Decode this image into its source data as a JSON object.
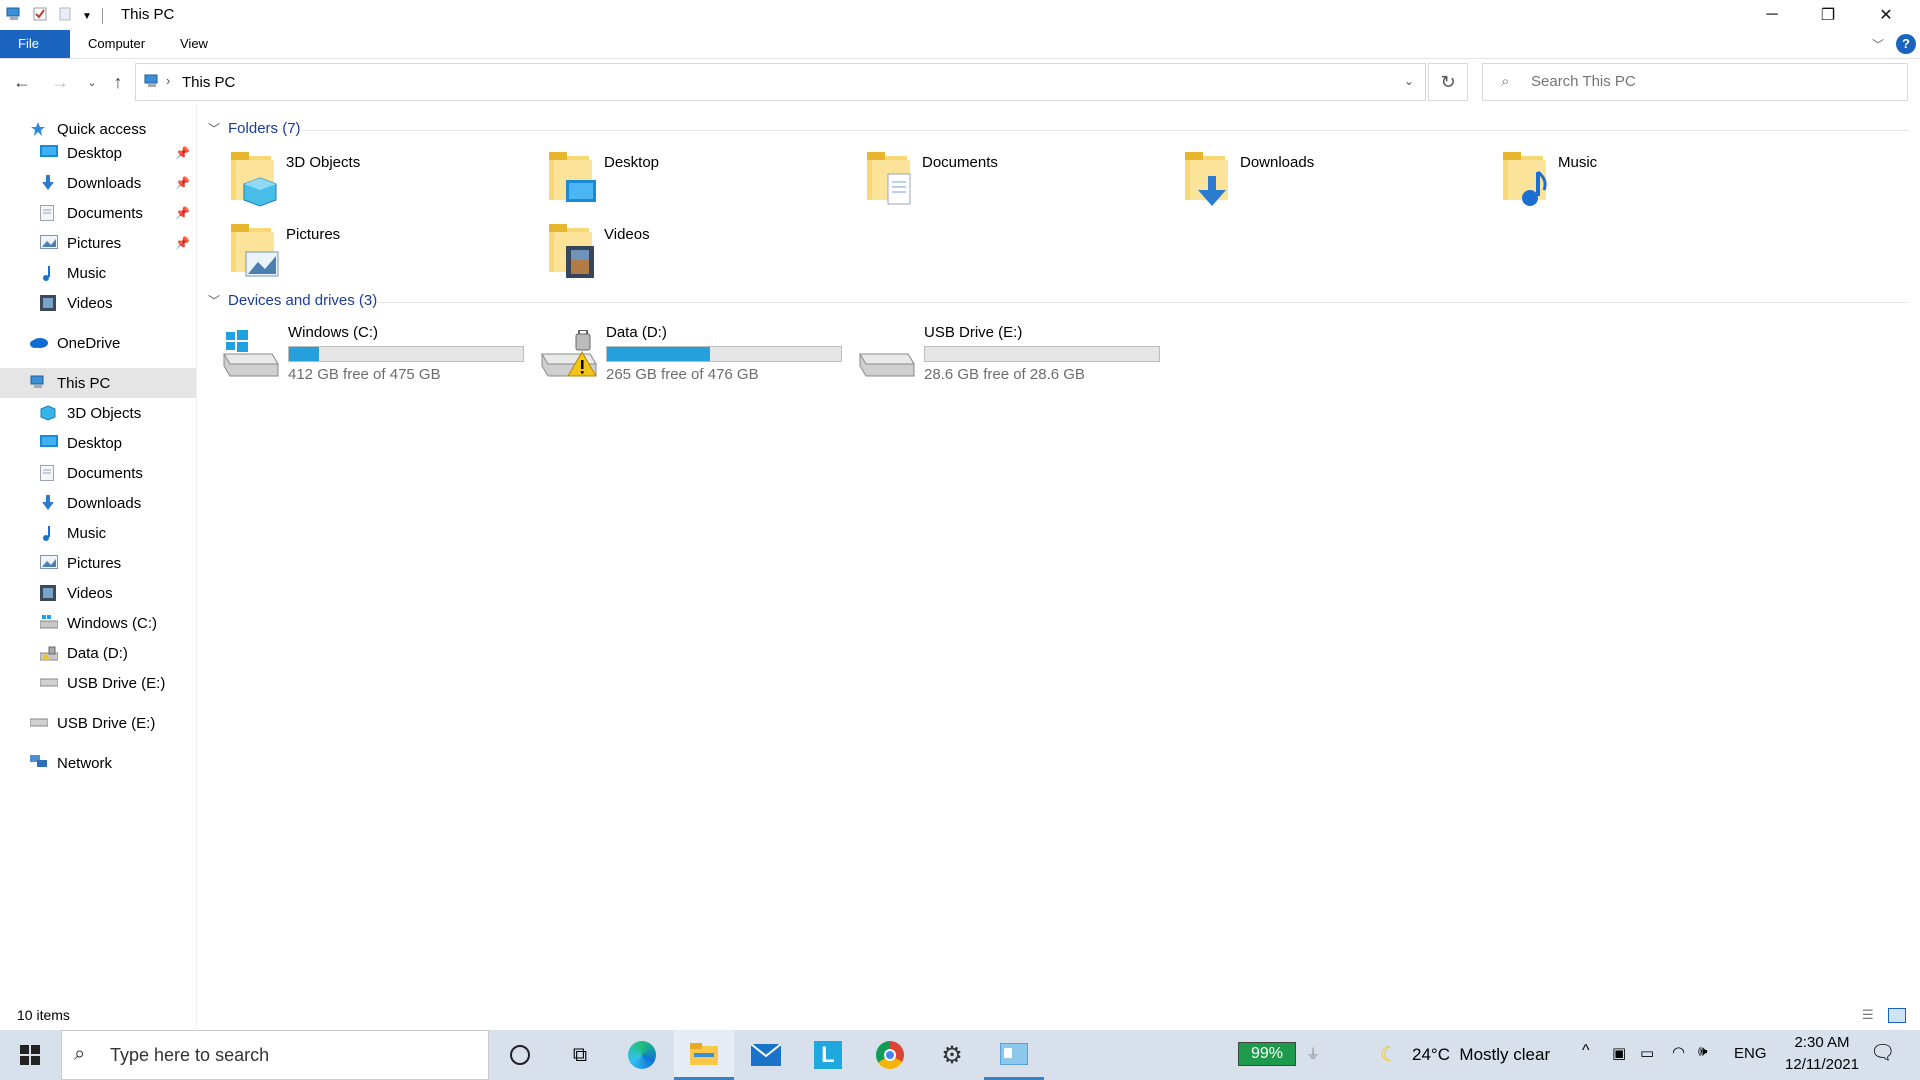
{
  "window": {
    "title": "This PC"
  },
  "ribbon": {
    "tabs": [
      "File",
      "Computer",
      "View"
    ]
  },
  "address": {
    "path": "This PC",
    "search_placeholder": "Search This PC"
  },
  "sidebar": {
    "items": [
      {
        "label": "Quick access",
        "icon": "star-icon",
        "indent": 0,
        "pinned": false
      },
      {
        "label": "Desktop",
        "icon": "desktop-icon",
        "indent": 1,
        "pinned": true
      },
      {
        "label": "Downloads",
        "icon": "downloads-icon",
        "indent": 1,
        "pinned": true
      },
      {
        "label": "Documents",
        "icon": "documents-icon",
        "indent": 1,
        "pinned": true
      },
      {
        "label": "Pictures",
        "icon": "pictures-icon",
        "indent": 1,
        "pinned": true
      },
      {
        "label": "Music",
        "icon": "music-icon",
        "indent": 1,
        "pinned": false
      },
      {
        "label": "Videos",
        "icon": "videos-icon",
        "indent": 1,
        "pinned": false
      },
      {
        "label": "OneDrive",
        "icon": "cloud-icon",
        "indent": 0,
        "pinned": false
      },
      {
        "label": "This PC",
        "icon": "computer-icon",
        "indent": 0,
        "pinned": false,
        "selected": true
      },
      {
        "label": "3D Objects",
        "icon": "3d-objects-icon",
        "indent": 1,
        "pinned": false
      },
      {
        "label": "Desktop",
        "icon": "desktop-icon",
        "indent": 1,
        "pinned": false
      },
      {
        "label": "Documents",
        "icon": "documents-icon",
        "indent": 1,
        "pinned": false
      },
      {
        "label": "Downloads",
        "icon": "downloads-icon",
        "indent": 1,
        "pinned": false
      },
      {
        "label": "Music",
        "icon": "music-icon",
        "indent": 1,
        "pinned": false
      },
      {
        "label": "Pictures",
        "icon": "pictures-icon",
        "indent": 1,
        "pinned": false
      },
      {
        "label": "Videos",
        "icon": "videos-icon",
        "indent": 1,
        "pinned": false
      },
      {
        "label": "Windows (C:)",
        "icon": "windows-drive-icon",
        "indent": 1,
        "pinned": false
      },
      {
        "label": "Data (D:)",
        "icon": "locked-drive-icon",
        "indent": 1,
        "pinned": false
      },
      {
        "label": "USB Drive (E:)",
        "icon": "usb-drive-icon",
        "indent": 1,
        "pinned": false
      },
      {
        "label": "USB Drive (E:)",
        "icon": "usb-drive-icon",
        "indent": 0,
        "pinned": false
      },
      {
        "label": "Network",
        "icon": "network-icon",
        "indent": 0,
        "pinned": false
      }
    ]
  },
  "content": {
    "folders_header": "Folders (7)",
    "folders": [
      {
        "name": "3D Objects",
        "icon": "3d-objects-folder-icon"
      },
      {
        "name": "Desktop",
        "icon": "desktop-folder-icon"
      },
      {
        "name": "Documents",
        "icon": "documents-folder-icon"
      },
      {
        "name": "Downloads",
        "icon": "downloads-folder-icon"
      },
      {
        "name": "Music",
        "icon": "music-folder-icon"
      },
      {
        "name": "Pictures",
        "icon": "pictures-folder-icon"
      },
      {
        "name": "Videos",
        "icon": "videos-folder-icon"
      }
    ],
    "drives_header": "Devices and drives (3)",
    "drives": [
      {
        "name": "Windows (C:)",
        "free_text": "412 GB free of 475 GB",
        "used_fraction": 0.13,
        "icon": "windows-drive-icon"
      },
      {
        "name": "Data (D:)",
        "free_text": "265 GB free of 476 GB",
        "used_fraction": 0.44,
        "icon": "locked-drive-warning-icon"
      },
      {
        "name": "USB Drive (E:)",
        "free_text": "28.6 GB free of 28.6 GB",
        "used_fraction": 0.0,
        "icon": "usb-drive-icon"
      }
    ]
  },
  "status": {
    "items": "10 items"
  },
  "taskbar": {
    "search_placeholder": "Type here to search",
    "battery": "99%",
    "weather": "24°C  Mostly clear",
    "language": "ENG",
    "time": "2:30 AM",
    "date": "12/11/2021",
    "accent": "#1a64c0"
  }
}
